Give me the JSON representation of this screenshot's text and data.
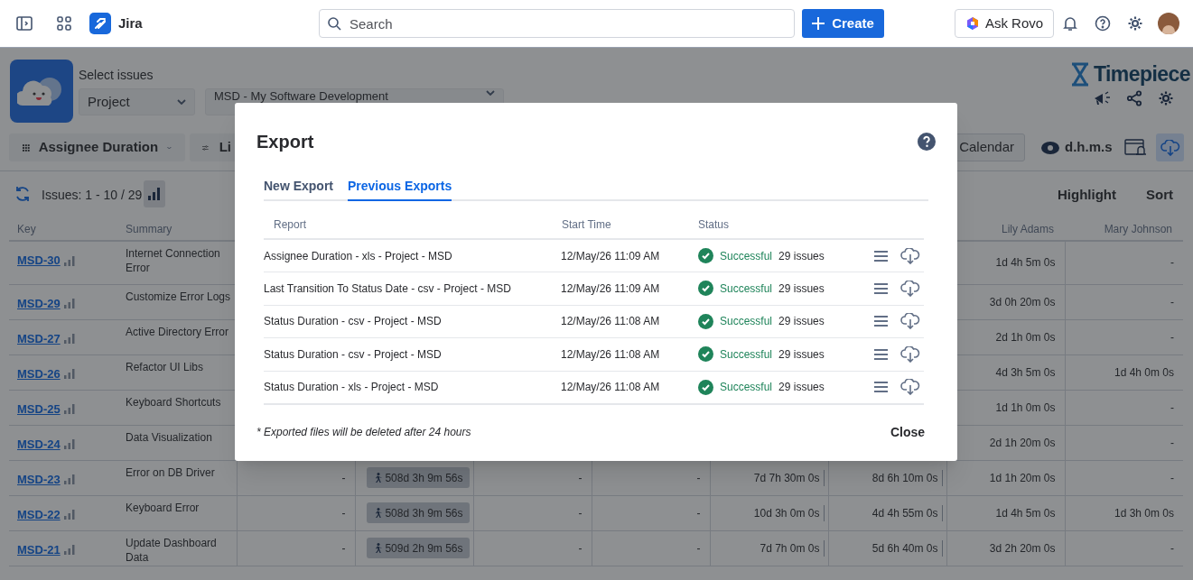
{
  "topbar": {
    "app_name": "Jira",
    "search": {
      "placeholder": "Search"
    },
    "create_button": "Create",
    "ask_button": "Ask Rovo"
  },
  "header": {
    "select_label": "Select issues",
    "scope_dropdown": "Project",
    "project_dropdown": "MSD - My Software Development",
    "brand": "Timepiece"
  },
  "toolbar": {
    "report_dropdown": "Assignee Duration",
    "filter_button": "Li",
    "calendar_button": "Calendar",
    "format_toggle": "d.h.m.s",
    "export_selected": true
  },
  "issues_bar": {
    "count": "Issues: 1 - 10 / 29",
    "actions": [
      "Highlight",
      "Sort"
    ]
  },
  "table": {
    "columns": [
      "Key",
      "Summary",
      null,
      null,
      null,
      null,
      null,
      null,
      "Lily Adams",
      "Mary Johnson"
    ],
    "rows": [
      {
        "key": "MSD-30",
        "summary": "Internet Connection Error",
        "cells": [
          null,
          null,
          null,
          null,
          null,
          null,
          "1d 4h 5m 0s",
          "-"
        ]
      },
      {
        "key": "MSD-29",
        "summary": "Customize Error Logs",
        "cells": [
          null,
          null,
          null,
          null,
          null,
          null,
          "3d 0h 20m 0s",
          "-"
        ]
      },
      {
        "key": "MSD-27",
        "summary": "Active Directory Error",
        "cells": [
          null,
          null,
          null,
          null,
          null,
          null,
          "2d 1h 0m 0s",
          "-"
        ]
      },
      {
        "key": "MSD-26",
        "summary": "Refactor UI Libs",
        "cells": [
          null,
          null,
          null,
          null,
          null,
          null,
          "4d 3h 5m 0s",
          "1d 4h 0m 0s"
        ]
      },
      {
        "key": "MSD-25",
        "summary": "Keyboard Shortcuts",
        "cells": [
          null,
          null,
          null,
          null,
          null,
          null,
          "1d 1h 0m 0s",
          "-"
        ]
      },
      {
        "key": "MSD-24",
        "summary": "Data Visualization",
        "cells": [
          null,
          null,
          null,
          null,
          null,
          null,
          "2d 1h 20m 0s",
          "-"
        ]
      },
      {
        "key": "MSD-23",
        "summary": "Error on DB Driver",
        "cells": [
          "-",
          "508d 3h 9m 56s",
          "-",
          "-",
          "7d 7h 30m 0s",
          "8d 6h 10m 0s",
          "1d 1h 20m 0s",
          "-"
        ]
      },
      {
        "key": "MSD-22",
        "summary": "Keyboard Error",
        "cells": [
          "-",
          "508d 3h 9m 56s",
          "-",
          "-",
          "10d 3h 0m 0s",
          "4d 4h 55m 0s",
          "1d 4h 5m 0s",
          "1d 3h 0m 0s"
        ]
      },
      {
        "key": "MSD-21",
        "summary": "Update Dashboard Data",
        "cells": [
          "-",
          "509d 2h 9m 56s",
          "-",
          "-",
          "7d 7h 0m 0s",
          "5d 6h 40m 0s",
          "3d 2h 20m 0s",
          "-"
        ]
      }
    ]
  },
  "modal": {
    "title": "Export",
    "tabs": [
      {
        "label": "New Export",
        "selected": false
      },
      {
        "label": "Previous Exports",
        "selected": true
      }
    ],
    "columns": [
      "Report",
      "Start Time",
      "Status"
    ],
    "rows": [
      {
        "report": "Assignee Duration - xls - Project - MSD",
        "start_time": "12/May/26 11:09 AM",
        "status": "Successful",
        "issues": "29 issues"
      },
      {
        "report": "Last Transition To Status Date - csv - Project - MSD",
        "start_time": "12/May/26 11:09 AM",
        "status": "Successful",
        "issues": "29 issues"
      },
      {
        "report": "Status Duration - csv - Project - MSD",
        "start_time": "12/May/26 11:08 AM",
        "status": "Successful",
        "issues": "29 issues"
      },
      {
        "report": "Status Duration - csv - Project - MSD",
        "start_time": "12/May/26 11:08 AM",
        "status": "Successful",
        "issues": "29 issues"
      },
      {
        "report": "Status Duration - xls - Project - MSD",
        "start_time": "12/May/26 11:08 AM",
        "status": "Successful",
        "issues": "29 issues"
      }
    ],
    "note": "* Exported files will be deleted after 24 hours",
    "close_button": "Close"
  }
}
